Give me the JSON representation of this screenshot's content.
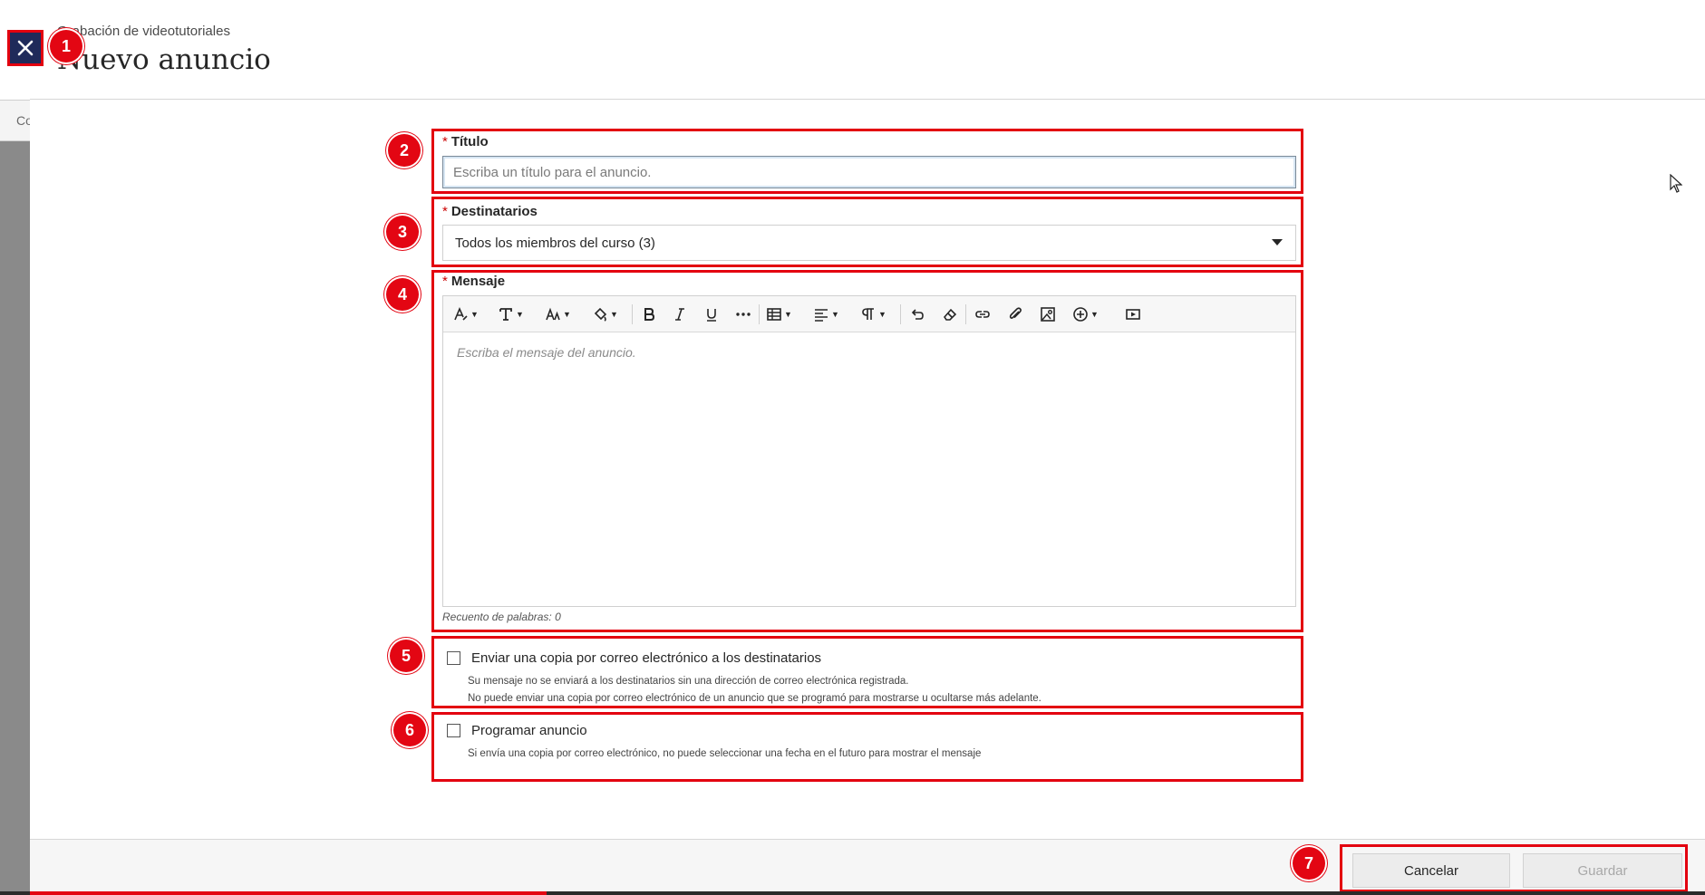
{
  "background": {
    "row_label": "Co"
  },
  "header": {
    "breadcrumb": "Grabación de videotutoriales",
    "title": "Nuevo anuncio",
    "close_label": "✕"
  },
  "form": {
    "title_field": {
      "label": "Título",
      "required_mark": "*",
      "placeholder": "Escriba un título para el anuncio."
    },
    "recipients_field": {
      "label": "Destinatarios",
      "required_mark": "*",
      "selected": "Todos los miembros del curso (3)"
    },
    "message_field": {
      "label": "Mensaje",
      "required_mark": "*",
      "placeholder": "Escriba el mensaje del anuncio.",
      "word_count": "Recuento de palabras: 0",
      "toolbar": [
        "paragraph-style-icon",
        "font-family-icon",
        "font-size-icon",
        "fill-color-icon",
        "bold-icon",
        "italic-icon",
        "underline-icon",
        "more-icon",
        "table-icon",
        "align-icon",
        "paragraph-mark-icon",
        "undo-icon",
        "eraser-icon",
        "link-icon",
        "attach-icon",
        "image-icon",
        "insert-plus-icon",
        "video-icon"
      ]
    },
    "email_copy": {
      "label": "Enviar una copia por correo electrónico a los destinatarios",
      "help1": "Su mensaje no se enviará a los destinatarios sin una dirección de correo electrónica registrada.",
      "help2": "No puede enviar una copia por correo electrónico de un anuncio que se programó para mostrarse u ocultarse más adelante.",
      "checked": false
    },
    "schedule": {
      "label": "Programar anuncio",
      "help": "Si envía una copia por correo electrónico, no puede seleccionar una fecha en el futuro para mostrar el mensaje",
      "checked": false
    }
  },
  "footer": {
    "cancel_label": "Cancelar",
    "save_label": "Guardar"
  },
  "callouts": [
    "1",
    "2",
    "3",
    "4",
    "5",
    "6",
    "7"
  ],
  "colors": {
    "accent_red": "#e30613",
    "close_button_bg": "#1f2a5a"
  }
}
